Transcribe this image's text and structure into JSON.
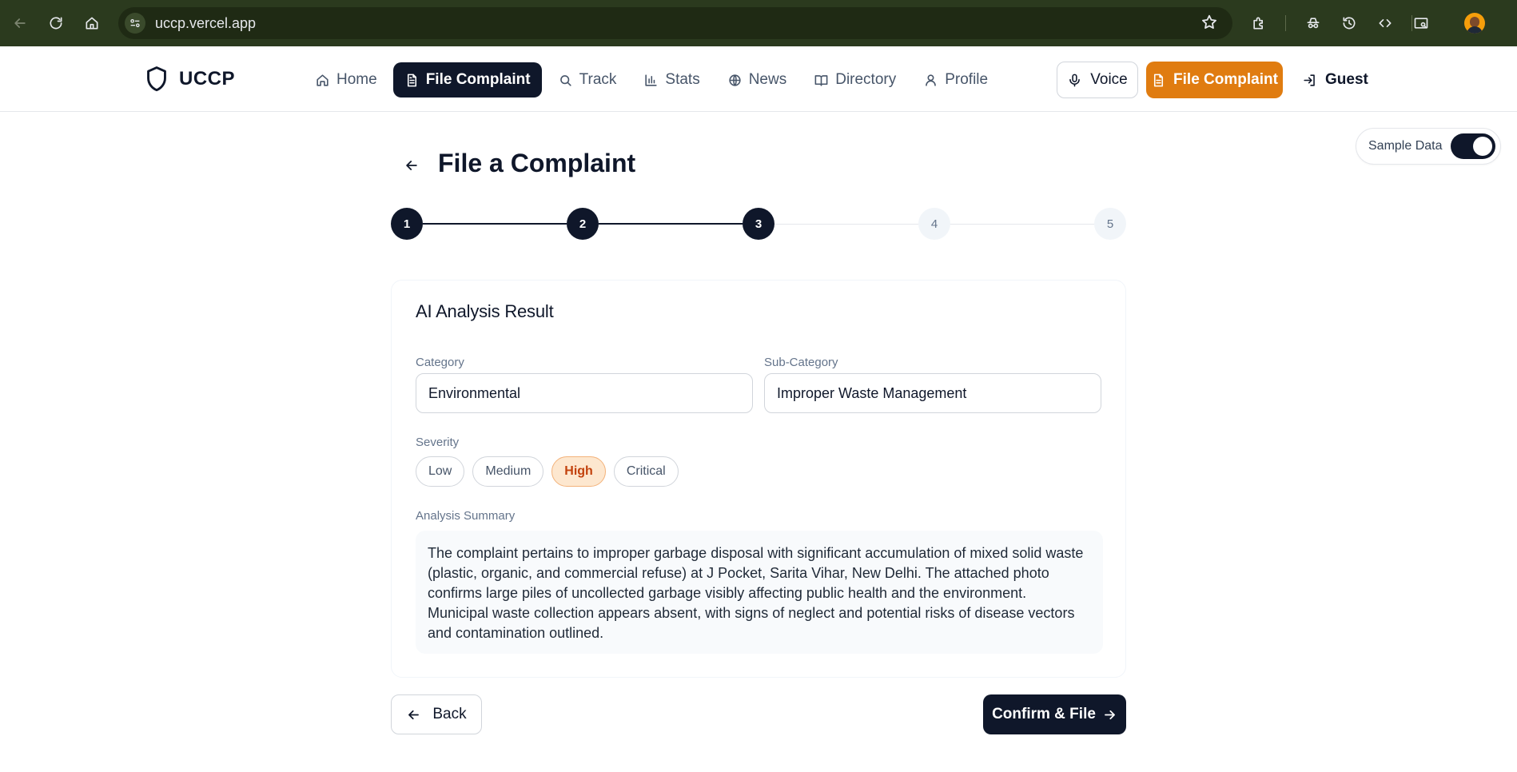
{
  "browser": {
    "url": "uccp.vercel.app"
  },
  "app": {
    "brand": "UCCP",
    "nav": [
      {
        "label": "Home",
        "icon": "home-icon",
        "active": false
      },
      {
        "label": "File Complaint",
        "icon": "file-icon",
        "active": true
      },
      {
        "label": "Track",
        "icon": "search-icon",
        "active": false
      },
      {
        "label": "Stats",
        "icon": "bar-chart-icon",
        "active": false
      },
      {
        "label": "News",
        "icon": "globe-icon",
        "active": false
      },
      {
        "label": "Directory",
        "icon": "book-icon",
        "active": false
      },
      {
        "label": "Profile",
        "icon": "user-icon",
        "active": false
      }
    ],
    "actions": {
      "voice": "Voice",
      "file_complaint": "File Complaint",
      "guest": "Guest"
    },
    "accent_color": "#e07c10",
    "primary_color": "#0f172a"
  },
  "sample_data": {
    "label": "Sample Data",
    "enabled": true
  },
  "page": {
    "title": "File a Complaint",
    "steps": [
      "1",
      "2",
      "3",
      "4",
      "5"
    ],
    "current_step": 3
  },
  "analysis": {
    "heading": "AI Analysis Result",
    "category_label": "Category",
    "category_value": "Environmental",
    "subcategory_label": "Sub-Category",
    "subcategory_value": "Improper Waste Management",
    "severity_label": "Severity",
    "severity_options": [
      "Low",
      "Medium",
      "High",
      "Critical"
    ],
    "severity_selected": "High",
    "summary_label": "Analysis Summary",
    "summary": "The complaint pertains to improper garbage disposal with significant accumulation of mixed solid waste (plastic, organic, and commercial refuse) at J Pocket, Sarita Vihar, New Delhi. The attached photo confirms large piles of uncollected garbage visibly affecting public health and the environment. Municipal waste collection appears absent, with signs of neglect and potential risks of disease vectors and contamination outlined."
  },
  "footer_buttons": {
    "back": "Back",
    "confirm": "Confirm & File"
  }
}
